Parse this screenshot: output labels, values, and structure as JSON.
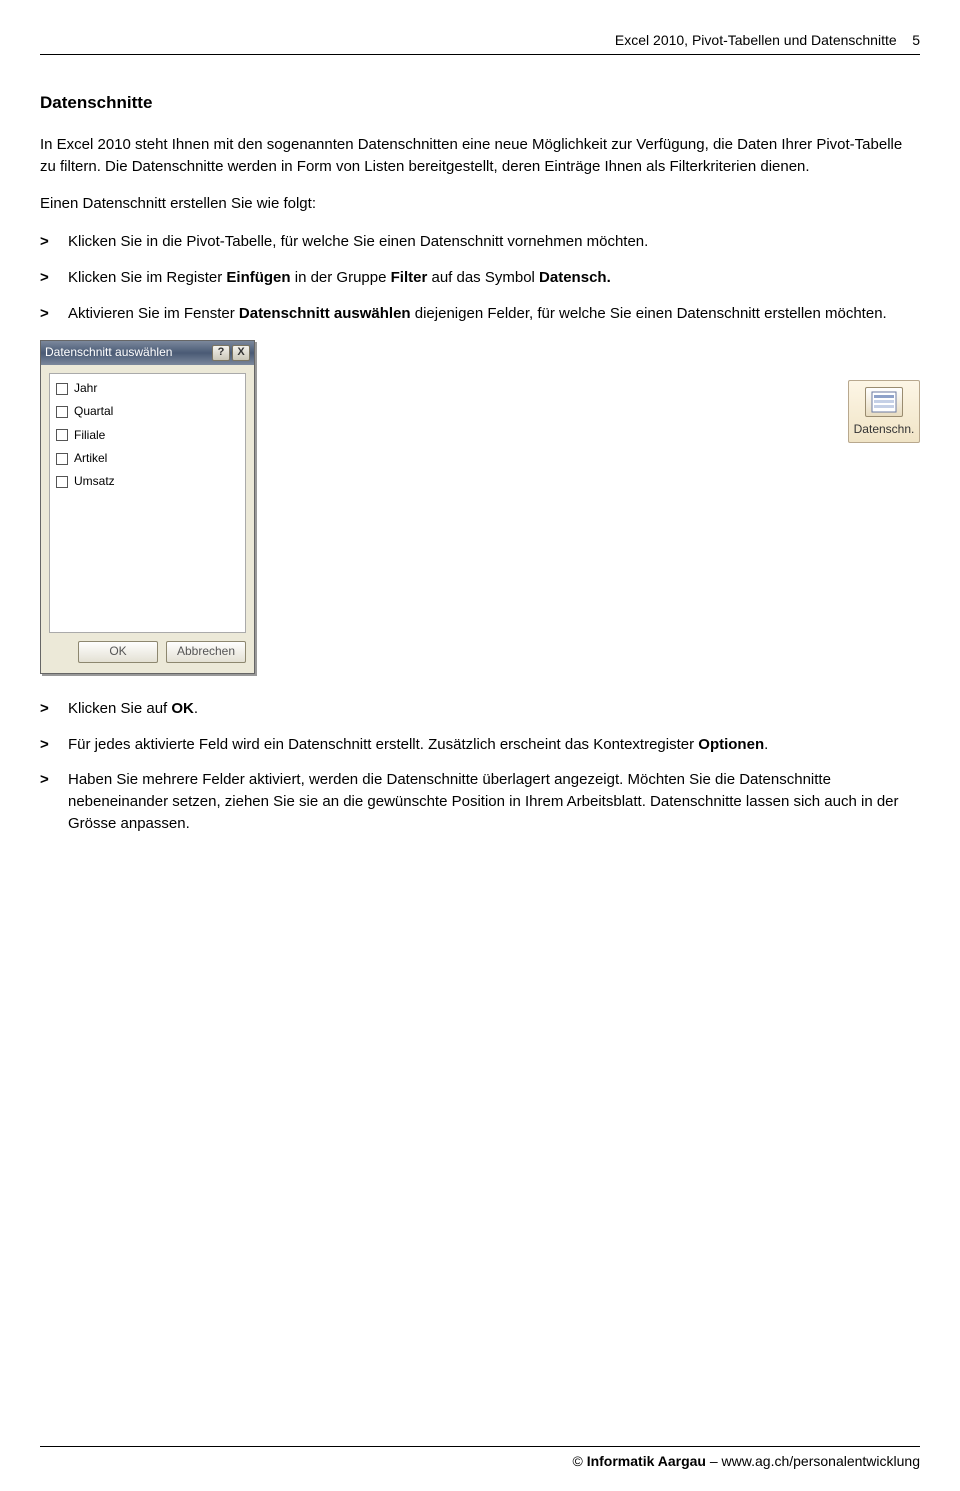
{
  "header": {
    "doc_title": "Excel 2010, Pivot-Tabellen und Datenschnitte",
    "page_num": "5"
  },
  "section": {
    "title": "Datenschnitte",
    "intro": "In Excel 2010 steht Ihnen mit den sogenannten Datenschnitten eine neue Möglichkeit zur Verfügung, die Daten Ihrer Pivot-Tabelle zu filtern. Die Datenschnitte werden in Form von Listen bereitgestellt, deren Einträge Ihnen als Filterkriterien dienen.",
    "lead": "Einen Datenschnitt erstellen Sie wie folgt:",
    "steps1": [
      {
        "pre": "Klicken Sie in die Pivot-Tabelle, für welche Sie einen Datenschnitt vornehmen möchten."
      },
      {
        "pre": "Klicken Sie im Register ",
        "b1": "Einfügen",
        "mid": " in der Gruppe ",
        "b2": "Filter",
        "mid2": " auf das Symbol ",
        "b3": "Datensch."
      },
      {
        "pre": "Aktivieren Sie im Fenster ",
        "b1": "Datenschnitt auswählen",
        "post": " diejenigen Felder, für welche Sie einen Datenschnitt erstellen möchten."
      }
    ],
    "steps2": [
      {
        "pre": "Klicken Sie auf ",
        "b1": "OK",
        "post": "."
      },
      {
        "pre": "Für jedes aktivierte Feld wird ein Datenschnitt erstellt. Zusätzlich erscheint das Kontextregister ",
        "b1": "Optionen",
        "post": "."
      },
      {
        "pre": "Haben Sie mehrere Felder aktiviert, werden die Datenschnitte überlagert angezeigt. Möchten Sie die Datenschnitte nebeneinander setzen, ziehen Sie sie an die gewünschte Position in Ihrem Arbeitsblatt. Datenschnitte lassen sich auch in der Grösse anpassen."
      }
    ]
  },
  "ribbon": {
    "label": "Datenschn."
  },
  "dialog": {
    "title": "Datenschnitt auswählen",
    "help": "?",
    "close": "X",
    "fields": [
      "Jahr",
      "Quartal",
      "Filiale",
      "Artikel",
      "Umsatz"
    ],
    "ok": "OK",
    "cancel": "Abbrechen"
  },
  "footer": {
    "org": "Informatik Aargau",
    "sep": " – ",
    "url": "www.ag.ch/personalentwicklung",
    "copy": "©  "
  }
}
